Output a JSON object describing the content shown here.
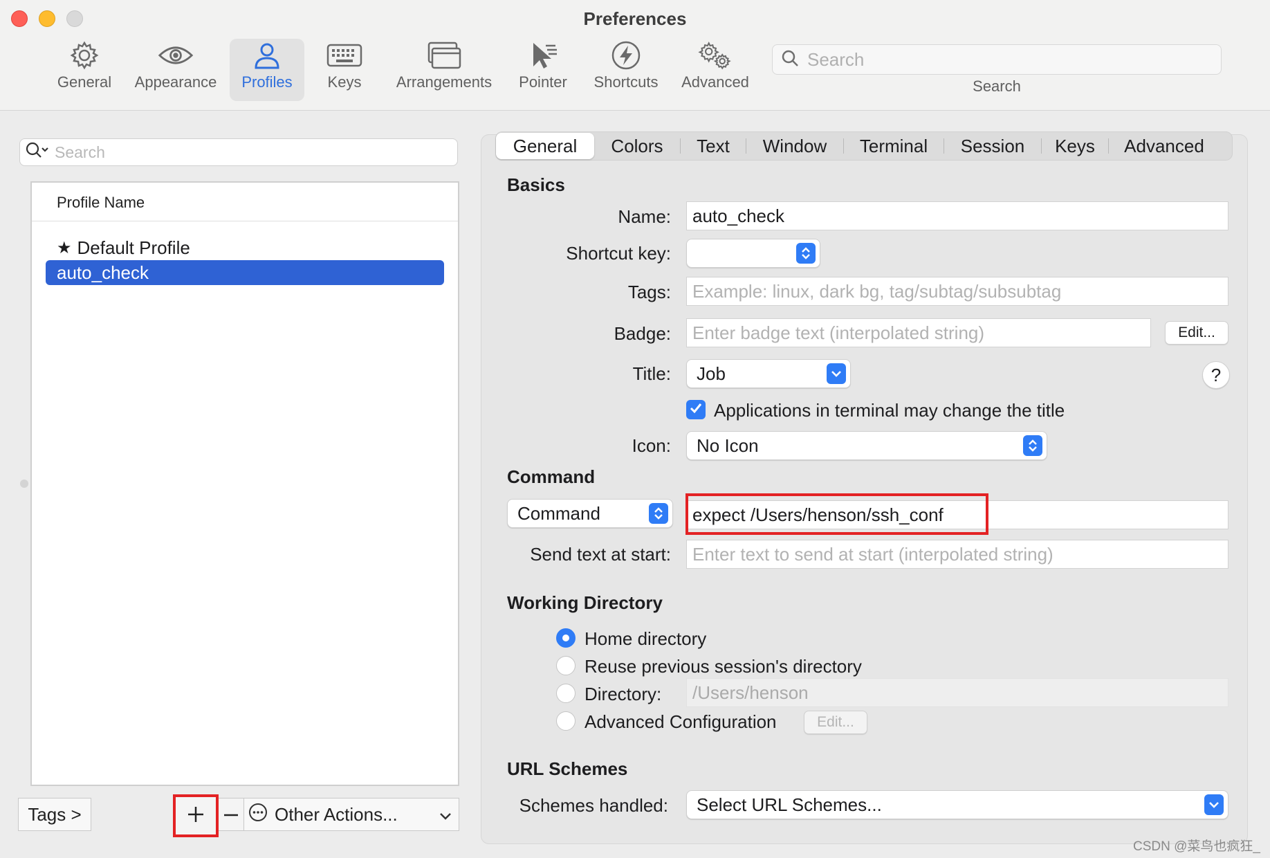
{
  "window": {
    "title": "Preferences"
  },
  "toolbar": {
    "items": [
      {
        "label": "General",
        "icon": "gear-icon"
      },
      {
        "label": "Appearance",
        "icon": "eye-icon"
      },
      {
        "label": "Profiles",
        "icon": "person-icon"
      },
      {
        "label": "Keys",
        "icon": "keyboard-icon"
      },
      {
        "label": "Arrangements",
        "icon": "window-stack-icon"
      },
      {
        "label": "Pointer",
        "icon": "pointer-icon"
      },
      {
        "label": "Shortcuts",
        "icon": "lightning-icon"
      },
      {
        "label": "Advanced",
        "icon": "gears-icon"
      }
    ],
    "active": "Profiles",
    "search_placeholder": "Search",
    "search_label": "Search"
  },
  "profiles": {
    "search_placeholder": "Search",
    "column_header": "Profile Name",
    "items": [
      {
        "name": "Default Profile",
        "default": true
      },
      {
        "name": "auto_check",
        "selected": true
      }
    ],
    "tags_label": "Tags >",
    "add_label": "+",
    "remove_label": "—",
    "other_actions_label": "Other Actions..."
  },
  "tabs": {
    "items": [
      "General",
      "Colors",
      "Text",
      "Window",
      "Terminal",
      "Session",
      "Keys",
      "Advanced"
    ],
    "active": "General"
  },
  "basics": {
    "title": "Basics",
    "name_label": "Name:",
    "name_value": "auto_check",
    "shortcut_label": "Shortcut key:",
    "shortcut_value": "",
    "tags_label": "Tags:",
    "tags_placeholder": "Example: linux, dark bg, tag/subtag/subsubtag",
    "badge_label": "Badge:",
    "badge_placeholder": "Enter badge text (interpolated string)",
    "badge_edit": "Edit...",
    "title_label": "Title:",
    "title_value": "Job",
    "help_label": "?",
    "apps_change_title": "Applications in terminal may change the title",
    "apps_change_title_checked": true,
    "icon_label": "Icon:",
    "icon_value": "No Icon"
  },
  "command": {
    "title": "Command",
    "mode_value": "Command",
    "command_value": "expect /Users/henson/ssh_conf",
    "send_text_label": "Send text at start:",
    "send_text_placeholder": "Enter text to send at start (interpolated string)"
  },
  "working_directory": {
    "title": "Working Directory",
    "options": [
      {
        "label": "Home directory",
        "selected": true
      },
      {
        "label": "Reuse previous session's directory",
        "selected": false
      },
      {
        "label": "Directory:",
        "selected": false
      },
      {
        "label": "Advanced Configuration",
        "selected": false
      }
    ],
    "directory_value": "/Users/henson",
    "advanced_edit": "Edit..."
  },
  "url_schemes": {
    "title": "URL Schemes",
    "label": "Schemes handled:",
    "value": "Select URL Schemes..."
  },
  "colors": {
    "accent": "#2f7cf6",
    "selection": "#2f62d4",
    "annotation_red": "#e32224"
  },
  "watermark": "CSDN @菜鸟也疯狂_"
}
